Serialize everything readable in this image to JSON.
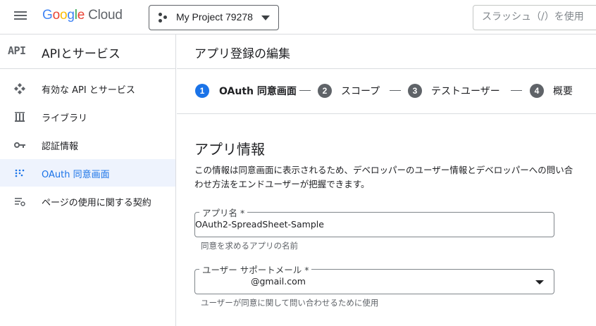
{
  "header": {
    "logo": [
      "G",
      "o",
      "o",
      "g",
      "l",
      "e"
    ],
    "logo_cloud": "Cloud",
    "project_name": "My Project 79278",
    "search_placeholder": "スラッシュ（/）を使用"
  },
  "sidebar": {
    "api_logo": "API",
    "title": "APIとサービス",
    "items": [
      {
        "label": "有効な API とサービス",
        "icon": "api-hub-icon",
        "active": false
      },
      {
        "label": "ライブラリ",
        "icon": "library-icon",
        "active": false
      },
      {
        "label": "認証情報",
        "icon": "key-icon",
        "active": false
      },
      {
        "label": "OAuth 同意画面",
        "icon": "oauth-consent-icon",
        "active": true
      },
      {
        "label": "ページの使用に関する契約",
        "icon": "settings-list-icon",
        "active": false
      }
    ]
  },
  "main": {
    "page_title": "アプリ登録の編集",
    "steps": [
      {
        "num": "1",
        "label": "OAuth 同意画面",
        "active": true
      },
      {
        "num": "2",
        "label": "スコープ",
        "active": false
      },
      {
        "num": "3",
        "label": "テストユーザー",
        "active": false
      },
      {
        "num": "4",
        "label": "概要",
        "active": false
      }
    ],
    "section_title": "アプリ情報",
    "section_desc": "この情報は同意画面に表示されるため、デベロッパーのユーザー情報とデベロッパーへの問い合わせ方法をエンドユーザーが把握できます。",
    "app_name": {
      "label": "アプリ名 *",
      "value": "OAuth2-SpreadSheet-Sample",
      "hint": "同意を求めるアプリの名前"
    },
    "support_email": {
      "label": "ユーザー サポートメール *",
      "value": "@gmail.com",
      "hint": "ユーザーが同意に関して問い合わせるために使用"
    }
  },
  "colors": {
    "accent": "#1a73e8",
    "active_bg": "#eef3fd",
    "step_inactive": "#5f6368"
  }
}
